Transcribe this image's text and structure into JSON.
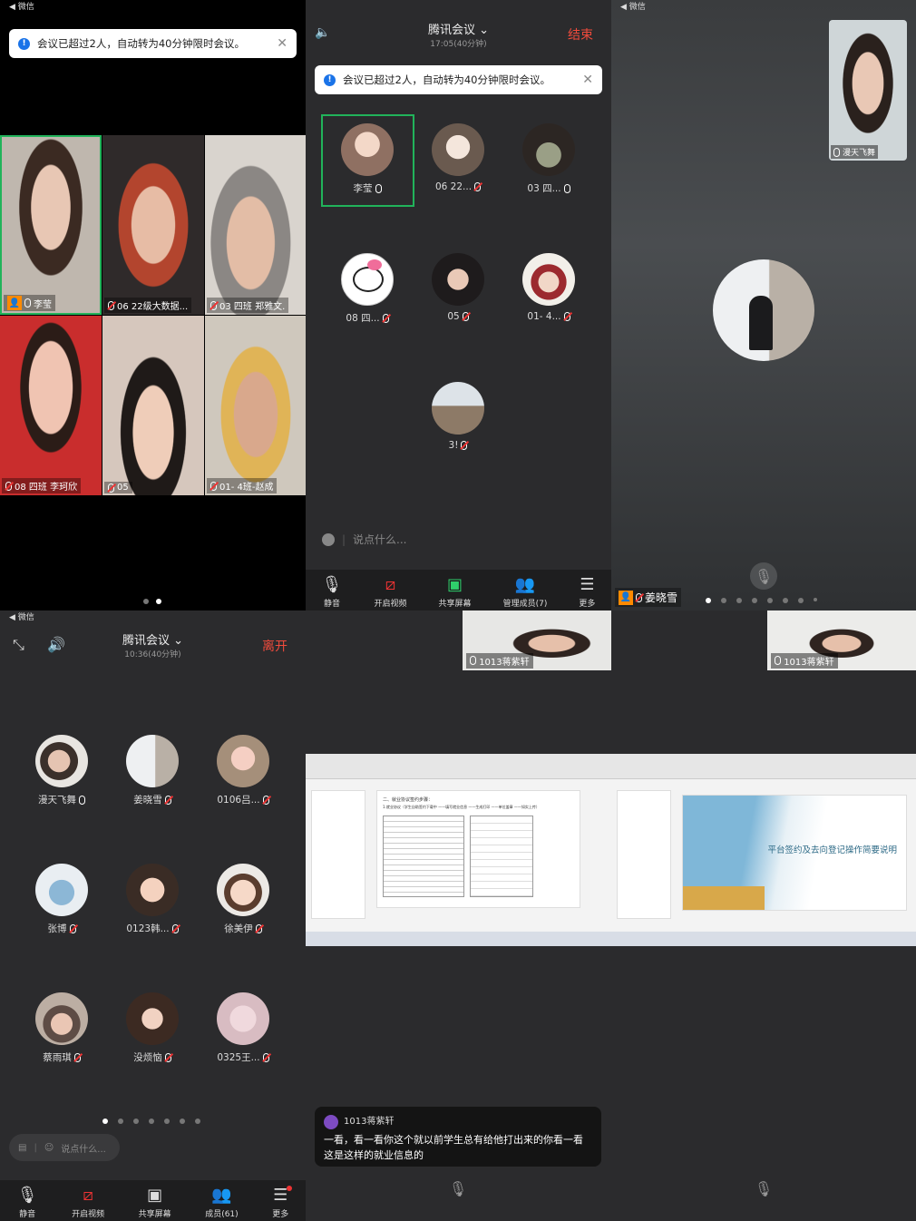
{
  "panel1": {
    "status": "◀ 微信",
    "notice": "会议已超过2人，自动转为40分钟限时会议。",
    "tiles": [
      {
        "name": "李莹",
        "host": true
      },
      {
        "name": "06 22级大数据..."
      },
      {
        "name": "03  四班 郑雅文."
      },
      {
        "name": "08  四班 李珂欣"
      },
      {
        "name": "05"
      },
      {
        "name": "01- 4班-赵成"
      }
    ]
  },
  "panel2": {
    "title": "腾讯会议",
    "subtitle": "17:05(40分钟)",
    "end_label": "结束",
    "notice": "会议已超过2人，自动转为40分钟限时会议。",
    "participants": [
      "李莹",
      "06 22...",
      "03  四...",
      "08  四...",
      "05",
      "01- 4...",
      "3!"
    ],
    "chat_placeholder": "说点什么...",
    "toolbar": [
      "静音",
      "开启视频",
      "共享屏幕",
      "管理成员(7)",
      "更多"
    ]
  },
  "panel3": {
    "status": "◀ 微信",
    "pip_name": "漫天飞舞",
    "speaker_name": "姜晓雪"
  },
  "panel4": {
    "status": "◀ 微信",
    "title": "腾讯会议",
    "subtitle": "10:36(40分钟)",
    "leave_label": "离开",
    "participants": [
      "漫天飞舞",
      "姜晓雪",
      "0106吕...",
      "张博",
      "0123韩...",
      "徐美伊",
      "蔡雨琪",
      "没烦恼",
      "0325王..."
    ],
    "chat_placeholder": "说点什么...",
    "toolbar": [
      "静音",
      "开启视频",
      "共享屏幕",
      "成员(61)",
      "更多"
    ]
  },
  "panel5": {
    "video_name": "1013蒋紫轩",
    "caption_name": "1013蒋紫轩",
    "caption_text": "一看，看一看你这个就以前学生总有给他打出来的你看一看这是这样的就业信息的",
    "doc_heading": "二、就业协议签约步骤：",
    "doc_line": "1.就业协议（学生自助签约下载中 ——填写就业信息 ——生成打印 ——单位盖章 ——如实上传）"
  },
  "panel6": {
    "video_name": "1013蒋紫轩",
    "slide_title": "平台签约及去向登记操作简要说明"
  },
  "colors": {
    "accent_green": "#21b35a",
    "end_red": "#f04b3c",
    "host_orange": "#ff8a00"
  }
}
